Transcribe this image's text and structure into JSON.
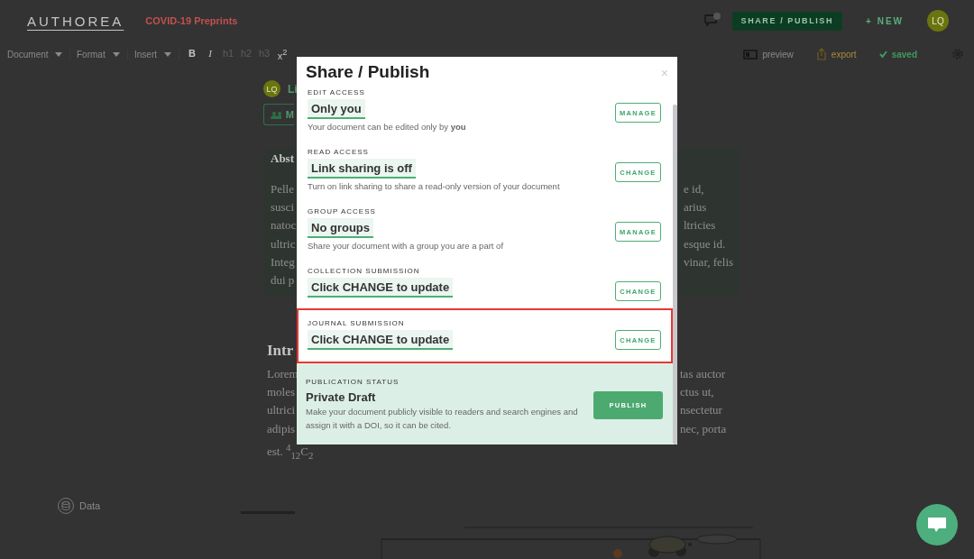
{
  "header": {
    "logo": "AUTHOREA",
    "collection": "COVID-19 Preprints",
    "share_button": "SHARE / PUBLISH",
    "new_button": "+ NEW",
    "avatar": "LQ"
  },
  "toolbar": {
    "menus": [
      "Document",
      "Format",
      "Insert"
    ],
    "buttons": [
      {
        "label": "B",
        "disabled": false
      },
      {
        "label": "I",
        "disabled": false
      },
      {
        "label": "h1",
        "disabled": true
      },
      {
        "label": "h2",
        "disabled": true
      },
      {
        "label": "h3",
        "disabled": true
      },
      {
        "label": "x$^{2}$",
        "disabled": false
      }
    ],
    "preview": "preview",
    "export": "export",
    "saved": "saved"
  },
  "document": {
    "author_avatar": "LQ",
    "author_fragment": "Li",
    "members_fragment": "M",
    "abstract_heading": "Abst",
    "abstract_lines": [
      {
        "left": "Pelle",
        "right": "e id,"
      },
      {
        "left": "susci",
        "right": "arius"
      },
      {
        "left": "natoc",
        "right": "ltricies"
      },
      {
        "left": "ultric",
        "right": "esque id."
      },
      {
        "left": "Integ",
        "right": "vinar, felis"
      },
      {
        "left": "dui p"
      }
    ],
    "intro_heading": "Intr",
    "intro_lines": [
      {
        "left": "Lorem",
        "right": "tas auctor"
      },
      {
        "left": "moles",
        "right": "ctus ut,"
      },
      {
        "left": "ultrici",
        "right": "nsectetur"
      },
      {
        "left": "adipis",
        "right": "nec, porta"
      },
      {
        "left": "est. $^{4}$$_{12}$C$_{2}$"
      }
    ],
    "sidebar_item": "Data"
  },
  "modal": {
    "title": "Share / Publish",
    "close": "×",
    "sections": [
      {
        "label": "EDIT ACCESS",
        "value": "Only you",
        "description": "Your document can be edited only by **you**",
        "button": "MANAGE",
        "highlighted": false
      },
      {
        "label": "READ ACCESS",
        "value": "Link sharing is off",
        "description": "Turn on link sharing to share a read-only version of your document",
        "button": "CHANGE",
        "highlighted": false
      },
      {
        "label": "GROUP ACCESS",
        "value": "No groups",
        "description": "Share your document with a group you are a part of",
        "button": "MANAGE",
        "highlighted": false
      },
      {
        "label": "COLLECTION SUBMISSION",
        "value": "Click CHANGE to update",
        "button": "CHANGE",
        "highlighted": false
      },
      {
        "label": "JOURNAL SUBMISSION",
        "value": "Click CHANGE to update",
        "button": "CHANGE",
        "highlighted": true
      }
    ],
    "publication": {
      "label": "PUBLICATION STATUS",
      "status": "Private Draft",
      "description": "Make your document publicly visible to readers and search engines and assign it with a DOI, so it can be cited.",
      "button": "PUBLISH"
    }
  }
}
